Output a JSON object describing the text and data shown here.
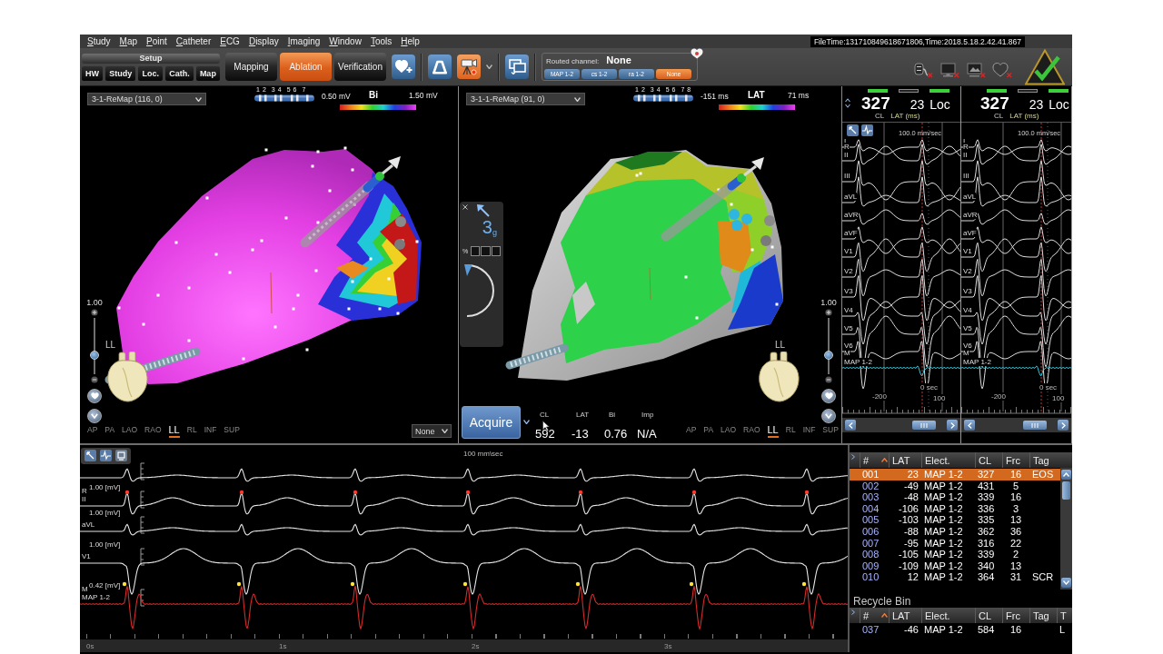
{
  "menu_bar": {
    "items": [
      "Study",
      "Map",
      "Point",
      "Catheter",
      "ECG",
      "Display",
      "Imaging",
      "Window",
      "Tools",
      "Help"
    ],
    "file_time": "FileTime:131710849618671806,Time:2018.5.18.2.42.41.867"
  },
  "toolbar": {
    "setup": {
      "title": "Setup",
      "buttons": [
        "HW",
        "Study",
        "Loc.",
        "Cath.",
        "Map"
      ]
    },
    "modes": [
      {
        "label": "Mapping",
        "selected": false
      },
      {
        "label": "Ablation",
        "selected": true
      },
      {
        "label": "Verification",
        "selected": false
      }
    ],
    "tool_groups": [
      [
        {
          "kind": "heart-add",
          "selected": false
        }
      ],
      [
        {
          "kind": "catheter",
          "selected": false
        },
        {
          "kind": "camera",
          "selected": true
        }
      ],
      [
        {
          "kind": "windows",
          "selected": false
        }
      ]
    ],
    "routed_channel": {
      "label": "Routed channel:",
      "value": "None",
      "channels": [
        {
          "label": "MAP 1-2",
          "selected": false
        },
        {
          "label": "cs 1-2",
          "selected": false
        },
        {
          "label": "ra 1-2",
          "selected": false
        },
        {
          "label": "None",
          "selected": true
        }
      ]
    },
    "connection_icons": [
      {
        "kind": "plug",
        "error": true
      },
      {
        "kind": "monitor",
        "error": true
      },
      {
        "kind": "workstation",
        "error": true
      },
      {
        "kind": "heart",
        "error": true
      }
    ],
    "system_ok": true
  },
  "maps": [
    {
      "kind": "voltage",
      "dropdown": "3-1-ReMap (116, 0)",
      "electrodes": [
        "1",
        "2",
        "3",
        "4",
        "5",
        "6",
        "7"
      ],
      "scale": {
        "min": "0.50 mV",
        "name": "Bi",
        "max": "1.50 mV"
      },
      "zoom_label": "1.00",
      "zoom_slider": {
        "level": 0.3
      },
      "orientation": "LL",
      "views": [
        {
          "label": "AP",
          "selected": false
        },
        {
          "label": "PA",
          "selected": false
        },
        {
          "label": "LAO",
          "selected": false
        },
        {
          "label": "RAO",
          "selected": false
        },
        {
          "label": "LL",
          "selected": true
        },
        {
          "label": "RL",
          "selected": false
        },
        {
          "label": "INF",
          "selected": false
        },
        {
          "label": "SUP",
          "selected": false
        }
      ],
      "overlay_select": "None"
    },
    {
      "kind": "activation",
      "dropdown": "3-1-1-ReMap (91, 0)",
      "electrodes": [
        "1",
        "2",
        "3",
        "4",
        "5",
        "6",
        "7",
        "8"
      ],
      "scale": {
        "min": "-151 ms",
        "name": "LAT",
        "max": "71 ms"
      },
      "force_panel": {
        "force": "3$_{g}$",
        "percent_label": "%"
      },
      "acquire": {
        "label": "Acquire",
        "readings": [
          {
            "label": "CL",
            "value": "592"
          },
          {
            "label": "LAT",
            "value": "-13"
          },
          {
            "label": "Bi",
            "value": "0.76"
          },
          {
            "label": "Imp",
            "value": "N/A"
          }
        ]
      },
      "zoom_label": "1.00",
      "zoom_slider": {
        "level": 0.3
      },
      "orientation": "LL",
      "views": [
        {
          "label": "AP",
          "selected": false
        },
        {
          "label": "PA",
          "selected": false
        },
        {
          "label": "LAO",
          "selected": false
        },
        {
          "label": "RAO",
          "selected": false
        },
        {
          "label": "LL",
          "selected": true
        },
        {
          "label": "RL",
          "selected": false
        },
        {
          "label": "INF",
          "selected": false
        },
        {
          "label": "SUP",
          "selected": false
        }
      ]
    }
  ],
  "ecg_panels": [
    {
      "toolbar": true,
      "indicators": [
        {
          "on": true
        },
        {
          "on": false
        },
        {
          "on": true
        }
      ],
      "cl_value": "327",
      "lat_value": "23",
      "mode": "Loc",
      "cl_label": "CL",
      "lat_label": "LAT (ms)",
      "speed": "100.0 mm/sec",
      "channels": [
        {
          "label": "I",
          "kind": "ecg"
        },
        {
          "label": "R",
          "kind": "marker"
        },
        {
          "label": "II",
          "kind": "ecg"
        },
        {
          "label": "III",
          "kind": "ecg"
        },
        {
          "label": "aVL",
          "kind": "ecg"
        },
        {
          "label": "aVR",
          "kind": "ecg"
        },
        {
          "label": "aVF",
          "kind": "ecg"
        },
        {
          "label": "V1",
          "kind": "ecg"
        },
        {
          "label": "V2",
          "kind": "ecg"
        },
        {
          "label": "V3",
          "kind": "ecg"
        },
        {
          "label": "V4",
          "kind": "ecg"
        },
        {
          "label": "V5",
          "kind": "ecg"
        },
        {
          "label": "V6",
          "kind": "ecg"
        },
        {
          "label": "M",
          "kind": "marker"
        },
        {
          "label": "MAP 1-2",
          "kind": "map"
        }
      ],
      "time_labels": [
        "-200",
        "0 sec",
        "100"
      ]
    },
    {
      "toolbar": false,
      "indicators": [
        {
          "on": true
        },
        {
          "on": false
        },
        {
          "on": true
        }
      ],
      "cl_value": "327",
      "lat_value": "23",
      "mode": "Loc",
      "cl_label": "CL",
      "lat_label": "LAT (ms)",
      "speed": "100.0 mm/sec",
      "channels": [
        {
          "label": "I",
          "kind": "ecg"
        },
        {
          "label": "R",
          "kind": "marker"
        },
        {
          "label": "II",
          "kind": "ecg"
        },
        {
          "label": "III",
          "kind": "ecg"
        },
        {
          "label": "aVL",
          "kind": "ecg"
        },
        {
          "label": "aVR",
          "kind": "ecg"
        },
        {
          "label": "aVF",
          "kind": "ecg"
        },
        {
          "label": "V1",
          "kind": "ecg"
        },
        {
          "label": "V2",
          "kind": "ecg"
        },
        {
          "label": "V3",
          "kind": "ecg"
        },
        {
          "label": "V4",
          "kind": "ecg"
        },
        {
          "label": "V5",
          "kind": "ecg"
        },
        {
          "label": "V6",
          "kind": "ecg"
        },
        {
          "label": "M",
          "kind": "marker"
        },
        {
          "label": "MAP 1-2",
          "kind": "map"
        }
      ],
      "time_labels": [
        "-200",
        "0 sec",
        "100"
      ]
    }
  ],
  "ecg_strip": {
    "speed": "100 mm\\sec",
    "traces": [
      {
        "kind": "ecg"
      },
      {
        "kind": "ecg-marked",
        "labels": [
          "R",
          "II"
        ],
        "scale": "1.00 [mV]"
      },
      {
        "kind": "ecg",
        "labels": [
          "aVL"
        ],
        "scale": "1.00 [mV]"
      },
      {
        "kind": "ecg",
        "labels": [
          "V1"
        ],
        "scale": "1.00 [mV]"
      },
      {
        "kind": "map",
        "labels": [
          "M",
          "MAP 1-2"
        ],
        "scale": "0.42 [mV]"
      }
    ],
    "time_labels": [
      "0s",
      "1s",
      "2s",
      "3s"
    ]
  },
  "points_table": {
    "columns": [
      {
        "label": "#",
        "sorted": true
      },
      {
        "label": "LAT",
        "sorted": false
      },
      {
        "label": "Elect.",
        "sorted": false
      },
      {
        "label": "CL",
        "sorted": false
      },
      {
        "label": "Frc",
        "sorted": false
      },
      {
        "label": "Tag",
        "sorted": false
      }
    ],
    "rows": [
      {
        "cells": [
          "001",
          "23",
          "MAP 1-2",
          "327",
          "16",
          "EOS"
        ],
        "selected": true
      },
      {
        "cells": [
          "002",
          "-49",
          "MAP 1-2",
          "431",
          "5"
        ],
        "selected": false
      },
      {
        "cells": [
          "003",
          "-48",
          "MAP 1-2",
          "339",
          "16"
        ],
        "selected": false
      },
      {
        "cells": [
          "004",
          "-106",
          "MAP 1-2",
          "336",
          "3"
        ],
        "selected": false
      },
      {
        "cells": [
          "005",
          "-103",
          "MAP 1-2",
          "335",
          "13"
        ],
        "selected": false
      },
      {
        "cells": [
          "006",
          "-88",
          "MAP 1-2",
          "362",
          "36"
        ],
        "selected": false
      },
      {
        "cells": [
          "007",
          "-95",
          "MAP 1-2",
          "316",
          "22"
        ],
        "selected": false
      },
      {
        "cells": [
          "008",
          "-105",
          "MAP 1-2",
          "339",
          "2"
        ],
        "selected": false
      },
      {
        "cells": [
          "009",
          "-109",
          "MAP 1-2",
          "340",
          "13"
        ],
        "selected": false
      },
      {
        "cells": [
          "010",
          "12",
          "MAP 1-2",
          "364",
          "31",
          "SCR"
        ],
        "selected": false
      }
    ]
  },
  "recycle_bin": {
    "title": "Recycle Bin",
    "columns": [
      {
        "label": "#",
        "sorted": true
      },
      {
        "label": "LAT",
        "sorted": false
      },
      {
        "label": "Elect.",
        "sorted": false
      },
      {
        "label": "CL",
        "sorted": false
      },
      {
        "label": "Frc",
        "sorted": false
      },
      {
        "label": "Tag",
        "sorted": false
      },
      {
        "label": "T",
        "sorted": false
      }
    ],
    "rows": [
      {
        "cells": [
          "037",
          "-46",
          "MAP 1-2",
          "584",
          "16",
          null,
          "L"
        ],
        "selected": false
      }
    ]
  }
}
